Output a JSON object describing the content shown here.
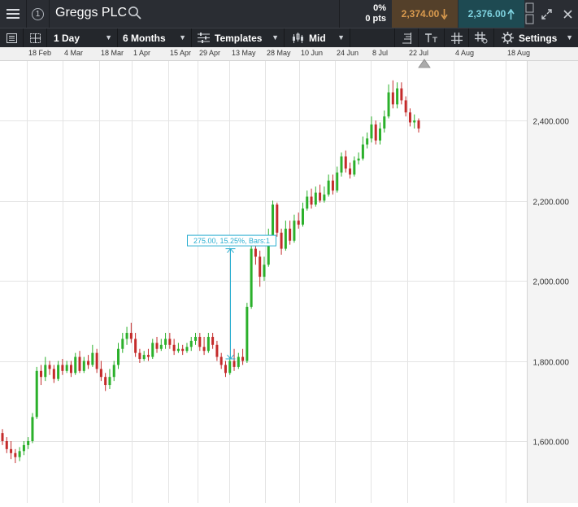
{
  "header": {
    "menu_icon": "hamburger-menu-icon",
    "info_icon_label": "1",
    "instrument_name": "Greggs PLC",
    "search_icon": "magnifier-icon",
    "change_percent": "0%",
    "change_points": "0 pts",
    "sell_price": "2,374.00",
    "sell_arrow": "down-arrow-icon",
    "buy_price": "2,376.00",
    "buy_arrow": "up-arrow-icon",
    "colors": {
      "sell_bg": "#54402a",
      "sell_text": "#d99a4e",
      "buy_bg": "#1e4a52",
      "buy_text": "#7fd3e0"
    }
  },
  "toolbar": {
    "interval": "1 Day",
    "range": "6 Months",
    "templates": "Templates",
    "price_type": "Mid",
    "settings": "Settings"
  },
  "time_axis": {
    "labels": [
      "18 Feb",
      "4 Mar",
      "18 Mar",
      "1 Apr",
      "15 Apr",
      "29 Apr",
      "13 May",
      "28 May",
      "10 Jun",
      "24 Jun",
      "8 Jul",
      "22 Jul",
      "4 Aug",
      "18 Aug"
    ],
    "current_label": "22 Jul"
  },
  "chart_data": {
    "type": "candlestick",
    "y_ticks": [
      "2,400.000",
      "2,200.000",
      "2,000.000",
      "1,800.000",
      "1,600.000"
    ],
    "ylim": [
      1450,
      2560
    ],
    "colors": {
      "up": "#2bb02b",
      "down": "#c42b2b",
      "grid": "#e4e4e4",
      "measure": "#2aaed0"
    },
    "measure_label": "275.00, 15.25%, Bars:1",
    "measure_from": 1805,
    "measure_to": 2080,
    "candles": [
      [
        1620,
        1600,
        1630,
        1590
      ],
      [
        1600,
        1580,
        1610,
        1570
      ],
      [
        1580,
        1570,
        1600,
        1555
      ],
      [
        1570,
        1560,
        1580,
        1545
      ],
      [
        1560,
        1575,
        1585,
        1550
      ],
      [
        1575,
        1590,
        1600,
        1565
      ],
      [
        1590,
        1600,
        1610,
        1580
      ],
      [
        1600,
        1660,
        1670,
        1595
      ],
      [
        1660,
        1775,
        1785,
        1655
      ],
      [
        1775,
        1760,
        1790,
        1740
      ],
      [
        1760,
        1790,
        1810,
        1750
      ],
      [
        1790,
        1780,
        1800,
        1765
      ],
      [
        1780,
        1755,
        1790,
        1745
      ],
      [
        1755,
        1790,
        1800,
        1750
      ],
      [
        1790,
        1775,
        1805,
        1765
      ],
      [
        1775,
        1790,
        1800,
        1770
      ],
      [
        1790,
        1770,
        1800,
        1760
      ],
      [
        1770,
        1810,
        1820,
        1765
      ],
      [
        1810,
        1775,
        1825,
        1770
      ],
      [
        1775,
        1800,
        1810,
        1770
      ],
      [
        1800,
        1790,
        1815,
        1780
      ],
      [
        1790,
        1820,
        1840,
        1785
      ],
      [
        1820,
        1780,
        1830,
        1770
      ],
      [
        1780,
        1760,
        1800,
        1750
      ],
      [
        1760,
        1740,
        1770,
        1725
      ],
      [
        1740,
        1760,
        1780,
        1730
      ],
      [
        1760,
        1790,
        1800,
        1750
      ],
      [
        1790,
        1830,
        1845,
        1780
      ],
      [
        1830,
        1855,
        1870,
        1820
      ],
      [
        1855,
        1870,
        1885,
        1840
      ],
      [
        1870,
        1855,
        1895,
        1845
      ],
      [
        1855,
        1820,
        1870,
        1810
      ],
      [
        1820,
        1805,
        1830,
        1795
      ],
      [
        1805,
        1815,
        1825,
        1800
      ],
      [
        1815,
        1810,
        1830,
        1800
      ],
      [
        1810,
        1845,
        1855,
        1805
      ],
      [
        1845,
        1830,
        1860,
        1820
      ],
      [
        1830,
        1840,
        1855,
        1825
      ],
      [
        1840,
        1855,
        1870,
        1830
      ],
      [
        1855,
        1840,
        1870,
        1830
      ],
      [
        1840,
        1825,
        1855,
        1815
      ],
      [
        1825,
        1830,
        1845,
        1820
      ],
      [
        1830,
        1825,
        1840,
        1815
      ],
      [
        1825,
        1835,
        1845,
        1820
      ],
      [
        1835,
        1850,
        1860,
        1825
      ],
      [
        1850,
        1860,
        1870,
        1840
      ],
      [
        1860,
        1835,
        1870,
        1825
      ],
      [
        1835,
        1825,
        1860,
        1815
      ],
      [
        1825,
        1860,
        1870,
        1820
      ],
      [
        1860,
        1840,
        1870,
        1830
      ],
      [
        1840,
        1810,
        1850,
        1800
      ],
      [
        1810,
        1790,
        1820,
        1780
      ],
      [
        1790,
        1770,
        1800,
        1760
      ],
      [
        1770,
        1800,
        1810,
        1765
      ],
      [
        1800,
        1785,
        1830,
        1775
      ],
      [
        1785,
        1810,
        1820,
        1780
      ],
      [
        1810,
        1800,
        1830,
        1790
      ],
      [
        1800,
        1935,
        1945,
        1795
      ],
      [
        1935,
        2080,
        2090,
        1930
      ],
      [
        2080,
        2060,
        2100,
        2040
      ],
      [
        2060,
        2010,
        2075,
        1985
      ],
      [
        2010,
        2040,
        2060,
        2000
      ],
      [
        2040,
        2110,
        2130,
        2035
      ],
      [
        2110,
        2190,
        2200,
        2100
      ],
      [
        2190,
        2120,
        2195,
        2110
      ],
      [
        2120,
        2080,
        2130,
        2065
      ],
      [
        2080,
        2130,
        2150,
        2075
      ],
      [
        2130,
        2100,
        2150,
        2090
      ],
      [
        2100,
        2150,
        2165,
        2095
      ],
      [
        2150,
        2140,
        2170,
        2130
      ],
      [
        2140,
        2180,
        2195,
        2135
      ],
      [
        2180,
        2210,
        2225,
        2175
      ],
      [
        2210,
        2190,
        2230,
        2180
      ],
      [
        2190,
        2220,
        2235,
        2185
      ],
      [
        2220,
        2200,
        2240,
        2195
      ],
      [
        2200,
        2215,
        2235,
        2195
      ],
      [
        2215,
        2250,
        2265,
        2210
      ],
      [
        2250,
        2225,
        2265,
        2215
      ],
      [
        2225,
        2270,
        2285,
        2220
      ],
      [
        2270,
        2310,
        2320,
        2260
      ],
      [
        2310,
        2280,
        2325,
        2270
      ],
      [
        2280,
        2265,
        2295,
        2255
      ],
      [
        2265,
        2300,
        2310,
        2260
      ],
      [
        2300,
        2305,
        2320,
        2290
      ],
      [
        2305,
        2340,
        2360,
        2300
      ],
      [
        2340,
        2355,
        2370,
        2330
      ],
      [
        2355,
        2390,
        2410,
        2345
      ],
      [
        2390,
        2350,
        2400,
        2340
      ],
      [
        2350,
        2380,
        2395,
        2340
      ],
      [
        2380,
        2410,
        2425,
        2370
      ],
      [
        2410,
        2470,
        2490,
        2405
      ],
      [
        2470,
        2440,
        2500,
        2430
      ],
      [
        2440,
        2480,
        2495,
        2430
      ],
      [
        2480,
        2450,
        2495,
        2440
      ],
      [
        2450,
        2420,
        2460,
        2410
      ],
      [
        2420,
        2395,
        2430,
        2385
      ],
      [
        2395,
        2400,
        2415,
        2380
      ],
      [
        2400,
        2380,
        2405,
        2370
      ]
    ]
  }
}
